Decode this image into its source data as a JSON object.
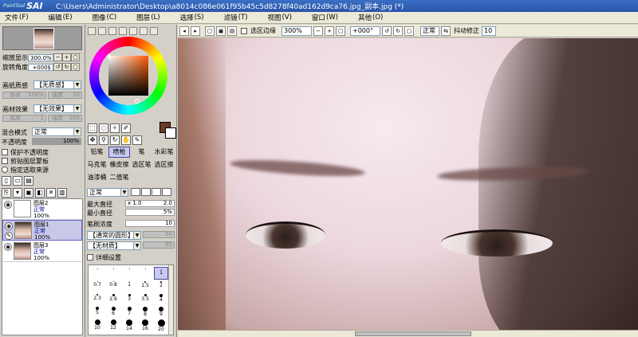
{
  "titlebar": {
    "logo_small": "PaintTool",
    "logo_big": "SAI",
    "title": "C:\\Users\\Administrator\\Desktop\\a8014c086e061f95b45c5d8278f40ad162d9ca76.jpg_副本.jpg (*)"
  },
  "menu": [
    {
      "label": "文件",
      "key": "(F)"
    },
    {
      "label": "编辑",
      "key": "(E)"
    },
    {
      "label": "图像",
      "key": "(C)"
    },
    {
      "label": "图层",
      "key": "(L)"
    },
    {
      "label": "选择",
      "key": "(S)"
    },
    {
      "label": "滤镜",
      "key": "(T)"
    },
    {
      "label": "视图",
      "key": "(V)"
    },
    {
      "label": "窗口",
      "key": "(W)"
    },
    {
      "label": "其他",
      "key": "(O)"
    }
  ],
  "navigator": {
    "zoom_label": "缩放显示",
    "zoom_value": "300.0%",
    "rotate_label": "旋转角度",
    "rotate_value": "+000$"
  },
  "paper_texture": {
    "label": "画纸质感",
    "value": "【无质感】",
    "sub1": "倍率",
    "sub1_val": "100%",
    "sub2": "强度",
    "sub2_val": "20"
  },
  "paper_effect": {
    "label": "画材效果",
    "value": "【无效果】",
    "sub1": "宽度",
    "sub1_val": "1",
    "sub2": "强度",
    "sub2_val": "100"
  },
  "blend": {
    "label": "混合模式",
    "value": "正常"
  },
  "opacity": {
    "label": "不透明度",
    "value": "100%"
  },
  "checks": {
    "preserve": "保护不透明度",
    "clip": "剪贴图层蒙板",
    "selection": "指定选取来源"
  },
  "layers": [
    {
      "name": "图层2",
      "mode": "正常",
      "opacity": "100%"
    },
    {
      "name": "图层1",
      "mode": "正常",
      "opacity": "100%"
    },
    {
      "name": "图层3",
      "mode": "正常",
      "opacity": "100%"
    }
  ],
  "tools": {
    "row1": [
      "铅笔",
      "喷枪",
      "笔",
      "水彩笔"
    ],
    "row2": [
      "马克笔",
      "橡皮擦",
      "选区笔",
      "选区擦"
    ],
    "row3": [
      "油漆桶",
      "二值笔",
      "",
      ""
    ]
  },
  "brush": {
    "mode": "正常",
    "max_size_label": "最大直径",
    "max_size_mult": "x 1.0",
    "max_size_val": "2.0",
    "min_size_label": "最小直径",
    "min_size_val": "5%",
    "density_label": "笔刷浓度",
    "density_val": "10",
    "shape": "【通常的圆形】",
    "shape_val": "50",
    "texture": "【无材质】",
    "texture_val": "95",
    "detail_label": "详细设置"
  },
  "brush_sizes": [
    [
      "",
      "",
      "",
      "",
      "1"
    ],
    [
      "0.7",
      "0.8",
      "1",
      "1.5",
      "2"
    ],
    [
      "2.3",
      "2.6",
      "3",
      "3.5",
      "4"
    ],
    [
      "5",
      "6",
      "7",
      "8",
      "9"
    ],
    [
      "10",
      "12",
      "14",
      "16",
      "20"
    ]
  ],
  "canvas_toolbar": {
    "selection_edge": "选区边缘",
    "zoom": "300%",
    "rotation": "+000°",
    "mode": "正常",
    "stabilizer_label": "抖动修正",
    "stabilizer_val": "10"
  },
  "colors": {
    "foreground": "#6b3a2a",
    "background": "#ffffff",
    "title_bar": "#2a55a8"
  }
}
